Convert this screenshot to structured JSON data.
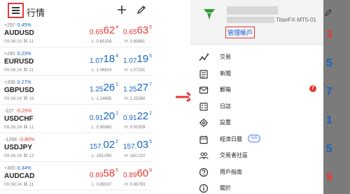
{
  "left": {
    "title": "行情",
    "quotes": [
      {
        "change_pts": "+297",
        "change_pct": "0.45%",
        "symbol": "AUDUSD",
        "time": "09:38:23 ⌘ 11",
        "bid": {
          "a": "0.65",
          "b": "62",
          "c": "4"
        },
        "ask": {
          "a": "0.65",
          "b": "63",
          "c": "5"
        },
        "low": "L: 0.65158",
        "high": "H: 0.65861",
        "color": "#e53935",
        "pct_color": "#1565c0"
      },
      {
        "change_pts": "+245",
        "change_pct": "0.23%",
        "symbol": "EURUSD",
        "time": "09:38:24 ⌘ 11",
        "bid": {
          "a": "1.07",
          "b": "18",
          "c": "4"
        },
        "ask": {
          "a": "1.07",
          "b": "19",
          "c": "5"
        },
        "low": "L: 1.06819",
        "high": "H: 1.07331",
        "color": "#1565c0",
        "pct_color": "#1565c0"
      },
      {
        "change_pts": "+338",
        "change_pct": "0.27%",
        "symbol": "GBPUSD",
        "time": "09:38:24 ⌘ 16",
        "bid": {
          "a": "1.25",
          "b": "26",
          "c": "1"
        },
        "ask": {
          "a": "1.25",
          "b": "27",
          "c": "7"
        },
        "low": "L: 1.24695",
        "high": "H: 1.25360",
        "color": "#1565c0",
        "pct_color": "#1565c0"
      },
      {
        "change_pts": "-227",
        "change_pct": "-0.25%",
        "symbol": "USDCHF",
        "time": "09:38:24 ⌘ 11",
        "bid": {
          "a": "0.91",
          "b": "20",
          "c": "1"
        },
        "ask": {
          "a": "0.91",
          "b": "22",
          "c": "1"
        },
        "low": "L: 0.90963",
        "high": "H: 0.91509",
        "color": "#1565c0",
        "pct_color": "#e53935"
      },
      {
        "change_pts": "-1268",
        "change_pct": "-0.80%",
        "symbol": "USDJPY",
        "time": "09:38:24 ⌘ 12",
        "bid": {
          "a": "157.",
          "b": "02",
          "c": "2"
        },
        "ask": {
          "a": "157.",
          "b": "03",
          "c": "5"
        },
        "low": "L: 155.050",
        "high": "H: 160.210",
        "color": "#1565c0",
        "pct_color": "#e53935"
      },
      {
        "change_pts": "+300",
        "change_pct": "0.34%",
        "symbol": "AUDCAD",
        "time": "09:38:24 ⌘ 11",
        "bid": {
          "a": "0.89",
          "b": "58",
          "c": "5"
        },
        "ask": {
          "a": "0.89",
          "b": "60",
          "c": "9"
        },
        "low": "L: 0.89037",
        "high": "H: 0.89783",
        "color": "#e53935",
        "pct_color": "#1565c0"
      }
    ]
  },
  "right": {
    "account_server": "TitanFX-MT5-01",
    "manage_label": "管理帳戶",
    "menu": [
      {
        "icon": "trade-chart-icon",
        "label": "交易"
      },
      {
        "icon": "news-icon",
        "label": "新聞"
      },
      {
        "icon": "mail-icon",
        "label": "郵箱",
        "badge": "7"
      },
      {
        "icon": "journal-icon",
        "label": "日誌"
      },
      {
        "icon": "settings-gear-icon",
        "label": "設置"
      },
      {
        "icon": "calendar-icon",
        "label": "經濟日曆",
        "tag": "Ads"
      },
      {
        "icon": "community-icon",
        "label": "交易者社區"
      },
      {
        "icon": "help-icon",
        "label": "用戶指南"
      },
      {
        "icon": "info-icon",
        "label": "關於"
      }
    ],
    "bg_digits": [
      {
        "text": "3",
        "color": "#e53935"
      },
      {
        "text": "5",
        "color": "#1565c0"
      },
      {
        "text": "7",
        "color": "#1565c0"
      },
      {
        "text": "1",
        "color": "#1565c0"
      },
      {
        "text": "5",
        "color": "#1565c0"
      },
      {
        "text": "9",
        "color": "#e53935"
      }
    ]
  },
  "colors": {
    "up": "#1565c0",
    "down": "#e53935",
    "highlight": "#e53935",
    "link": "#1e5bd6",
    "logo": "#2e9b3c"
  }
}
